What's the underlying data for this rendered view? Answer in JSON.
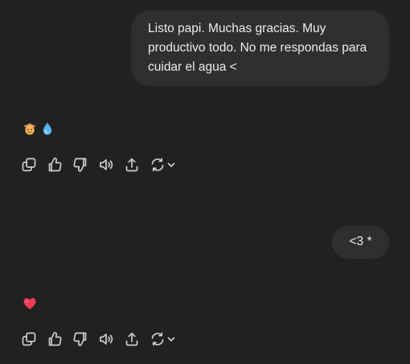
{
  "conversation": {
    "messages": [
      {
        "role": "user",
        "text": "Listo papi. Muchas gracias. Muy productivo todo. No me respondas para cuidar el agua <"
      },
      {
        "role": "assistant",
        "emojis": [
          "cowboy-face-emoji",
          "droplet-emoji"
        ]
      },
      {
        "role": "user",
        "text": "<3 *"
      },
      {
        "role": "assistant",
        "emojis": [
          "red-heart-emoji"
        ]
      }
    ]
  },
  "actions": {
    "icons": [
      "copy-icon",
      "thumbs-up-icon",
      "thumbs-down-icon",
      "read-aloud-icon",
      "share-icon",
      "regenerate-icon",
      "chevron-down-icon"
    ]
  },
  "colors": {
    "background": "#212121",
    "user_bubble": "#2f2f2f",
    "text": "#ececec",
    "icon": "#cdcdcd"
  }
}
